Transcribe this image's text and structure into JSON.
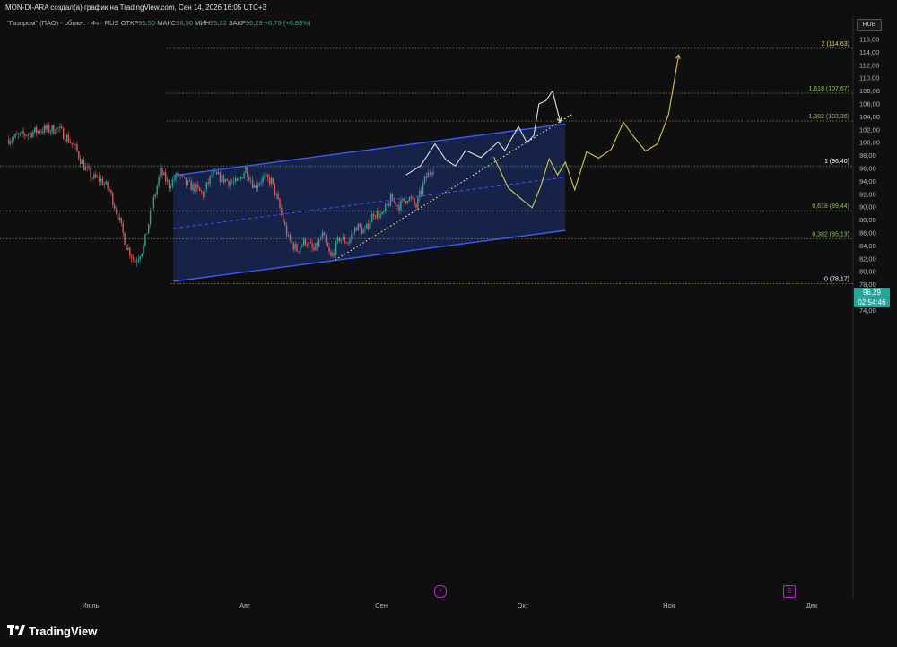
{
  "header": {
    "title": "MON-DI-ARA создал(а) график на TradingView.com, Сен 14, 2026 16:05 UTC+3"
  },
  "legend": {
    "symbol": "\"Газпром\" (ПАО) - обыкн. · 4ч · RUS",
    "open_label": "ОТКР",
    "open": "95,50",
    "high_label": "МАКС",
    "high": "96,50",
    "low_label": "МИН",
    "low": "95,22",
    "close_label": "ЗАКР",
    "close": "96,29",
    "change": "+0,79 (+0,83%)"
  },
  "currency": "RUB",
  "price_tag": {
    "price": "96,29",
    "countdown": "02:54:46"
  },
  "footer": {
    "brand": "TradingView"
  },
  "colors": {
    "up": "#26a69a",
    "down": "#ef5350",
    "channel": "#3d5afe",
    "channel_fill": "#1a2a5c",
    "fib_label": "#8bc34a",
    "fib_line": "#b7b76a",
    "projection_yellow": "#d8c84a",
    "projection_white": "#e0e0e0",
    "event": "#c026d3"
  },
  "chart_data": {
    "type": "candlestick",
    "title": "",
    "xlabel": "",
    "ylabel": "",
    "ylim": [
      73,
      116.5
    ],
    "y_ticks": [
      74,
      76,
      78,
      80,
      82,
      84,
      86,
      88,
      90,
      92,
      94,
      96,
      98,
      100,
      102,
      104,
      106,
      108,
      110,
      112,
      114,
      116
    ],
    "x_labels": [
      "Июль",
      "Авг",
      "Сен",
      "Окт",
      "Ноя",
      "Дек"
    ],
    "grid": false,
    "fib_levels": [
      {
        "label": "0 (78,17)",
        "value": 78.17
      },
      {
        "label": "0,382 (85,13)",
        "value": 85.13
      },
      {
        "label": "0,618 (89,44)",
        "value": 89.44
      },
      {
        "label": "1 (96,40)",
        "value": 96.4
      },
      {
        "label": "1,382 (103,36)",
        "value": 103.36
      },
      {
        "label": "1,618 (107,67)",
        "value": 107.67
      },
      {
        "label": "2 (114,63)",
        "value": 114.63
      }
    ],
    "price_path": [
      [
        0,
        100.5
      ],
      [
        4,
        102
      ],
      [
        6,
        102.1
      ],
      [
        7,
        100.8
      ],
      [
        8,
        99.1
      ],
      [
        9,
        96.3
      ],
      [
        10,
        94.6
      ],
      [
        11,
        94.2
      ],
      [
        12,
        92.6
      ],
      [
        13,
        88.7
      ],
      [
        14,
        84.0
      ],
      [
        15,
        81.6
      ],
      [
        16,
        83.8
      ],
      [
        17,
        90.0
      ],
      [
        18,
        95.5
      ],
      [
        19,
        93.4
      ],
      [
        20,
        95.0
      ],
      [
        21,
        93.6
      ],
      [
        22,
        93.0
      ],
      [
        23,
        92.0
      ],
      [
        24,
        95.0
      ],
      [
        25,
        94.6
      ],
      [
        26,
        94.0
      ],
      [
        27,
        93.6
      ],
      [
        28,
        96.0
      ],
      [
        29,
        93.2
      ],
      [
        30,
        94.5
      ],
      [
        31,
        94.0
      ],
      [
        32,
        89.8
      ],
      [
        33,
        85.0
      ],
      [
        34,
        83.4
      ],
      [
        35,
        84.8
      ],
      [
        36,
        83.2
      ],
      [
        37,
        85.6
      ],
      [
        38,
        82.1
      ],
      [
        39,
        85.2
      ],
      [
        40,
        84.6
      ],
      [
        41,
        87.1
      ],
      [
        42,
        86.1
      ],
      [
        43,
        89.2
      ],
      [
        44,
        88.6
      ],
      [
        45,
        91.2
      ],
      [
        46,
        90.2
      ],
      [
        47,
        91.6
      ],
      [
        48,
        90.1
      ],
      [
        49,
        94.2
      ],
      [
        50,
        96.29
      ]
    ],
    "channel": {
      "upper": [
        [
          19.5,
          94.9
        ],
        [
          65.5,
          102.9
        ]
      ],
      "lower": [
        [
          19.5,
          78.5
        ],
        [
          65.5,
          86.4
        ]
      ],
      "mid": [
        [
          19.5,
          86.7
        ],
        [
          65.5,
          94.65
        ]
      ]
    },
    "dotted_trend": [
      [
        38.5,
        81.8
      ],
      [
        66.3,
        104.4
      ]
    ],
    "projection_white": [
      [
        46.8,
        95.0
      ],
      [
        48.5,
        96.4
      ],
      [
        50.2,
        99.8
      ],
      [
        51.5,
        97.3
      ],
      [
        52.6,
        96.4
      ],
      [
        53.8,
        98.8
      ],
      [
        55.6,
        97.7
      ],
      [
        57.6,
        100.1
      ],
      [
        58.4,
        98.8
      ],
      [
        60,
        102.5
      ],
      [
        61,
        100.0
      ],
      [
        61.8,
        101.1
      ],
      [
        62.4,
        106.0
      ],
      [
        63.2,
        106.5
      ],
      [
        64.0,
        108.0
      ],
      [
        64.9,
        103.2
      ]
    ],
    "projection_yellow": [
      [
        57.1,
        97.8
      ],
      [
        58.8,
        93.0
      ],
      [
        60.4,
        91.2
      ],
      [
        61.6,
        89.9
      ],
      [
        62.6,
        93.2
      ],
      [
        63.6,
        97.5
      ],
      [
        64.6,
        95.0
      ],
      [
        65.5,
        97.0
      ],
      [
        66.6,
        92.7
      ],
      [
        68.0,
        98.6
      ],
      [
        69.4,
        97.6
      ],
      [
        70.9,
        99.0
      ],
      [
        72.3,
        103.2
      ],
      [
        73.6,
        100.8
      ],
      [
        74.9,
        98.7
      ],
      [
        76.3,
        99.8
      ],
      [
        77.6,
        104.3
      ],
      [
        78.8,
        113.6
      ]
    ]
  }
}
